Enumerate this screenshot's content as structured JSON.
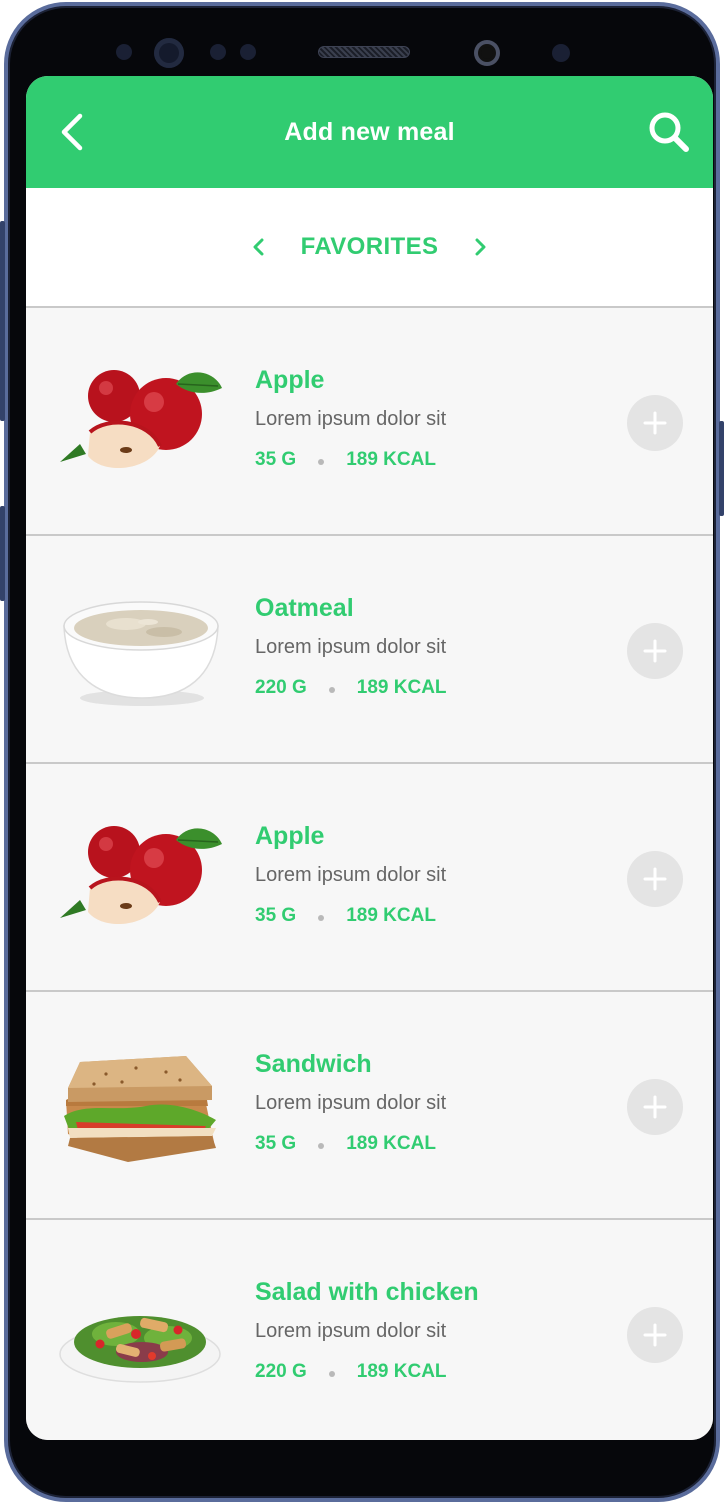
{
  "header": {
    "title": "Add new meal",
    "back_icon": "chevron-left-icon",
    "search_icon": "search-icon"
  },
  "category": {
    "label": "FAVORITES",
    "prev_icon": "chevron-left-icon",
    "next_icon": "chevron-right-icon"
  },
  "meals": [
    {
      "name": "Apple",
      "description": "Lorem ipsum dolor sit",
      "weight": "35 G",
      "calories": "189 KCAL",
      "image": "apple"
    },
    {
      "name": "Oatmeal",
      "description": "Lorem ipsum dolor sit",
      "weight": "220 G",
      "calories": "189 KCAL",
      "image": "oatmeal"
    },
    {
      "name": "Apple",
      "description": "Lorem ipsum dolor sit",
      "weight": "35 G",
      "calories": "189 KCAL",
      "image": "apple"
    },
    {
      "name": "Sandwich",
      "description": "Lorem ipsum dolor sit",
      "weight": "35 G",
      "calories": "189 KCAL",
      "image": "sandwich"
    },
    {
      "name": "Salad with chicken",
      "description": "Lorem ipsum dolor sit",
      "weight": "220 G",
      "calories": "189 KCAL",
      "image": "salad"
    }
  ],
  "colors": {
    "accent": "#31cc71",
    "row_bg": "#f7f7f7",
    "add_button": "#e4e4e4"
  }
}
